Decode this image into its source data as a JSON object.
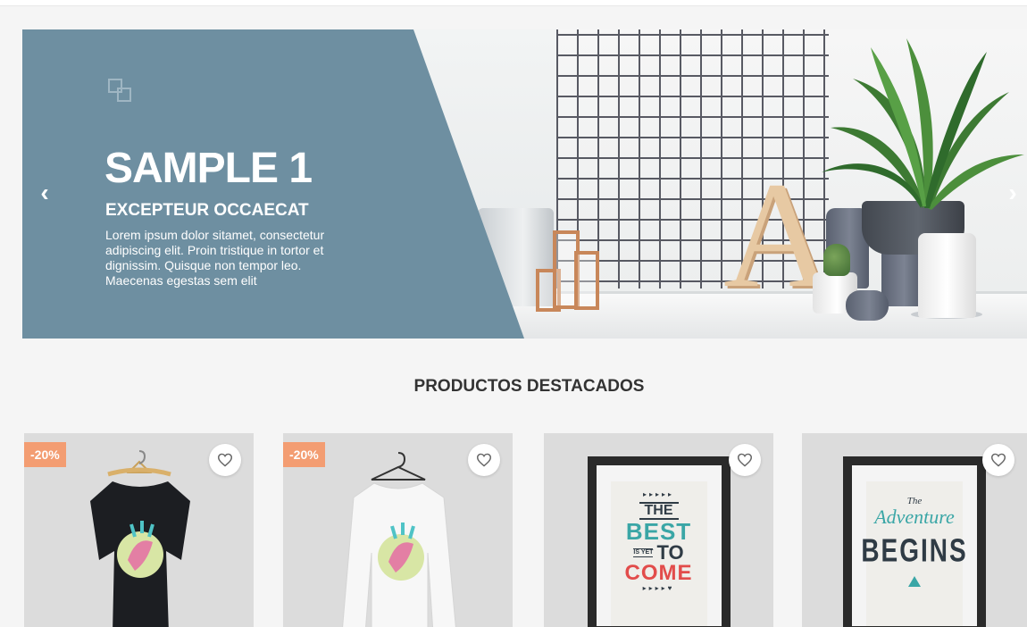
{
  "carousel": {
    "slide_title": "SAMPLE 1",
    "slide_subtitle": "EXCEPTEUR OCCAECAT",
    "slide_text": "Lorem ipsum dolor sitamet, consectetur\nadipiscing elit. Proin tristique in tortor et\ndignissim. Quisque non tempor leo.\nMaecenas egestas sem elit",
    "prev_icon": "‹",
    "next_icon": "›",
    "panel_color": "#6e8fa1"
  },
  "featured": {
    "title": "PRODUCTOS DESTACADOS",
    "products": [
      {
        "badge": "-20%",
        "kind": "black-tshirt",
        "wishlist_icon": "heart-outline-icon"
      },
      {
        "badge": "-20%",
        "kind": "white-longsleeve",
        "wishlist_icon": "heart-outline-icon"
      },
      {
        "badge": "",
        "kind": "poster-best-is-yet-to-come",
        "wishlist_icon": "heart-outline-icon",
        "poster": {
          "line1": "THE",
          "line2": "BEST",
          "line3": "IS YET",
          "line4": "TO",
          "line5": "COME"
        }
      },
      {
        "badge": "",
        "kind": "poster-adventure-begins",
        "wishlist_icon": "heart-outline-icon",
        "poster": {
          "line1": "The",
          "line2": "Adventure",
          "line3": "BEGINS"
        }
      }
    ],
    "badge_color": "#f39d72"
  }
}
